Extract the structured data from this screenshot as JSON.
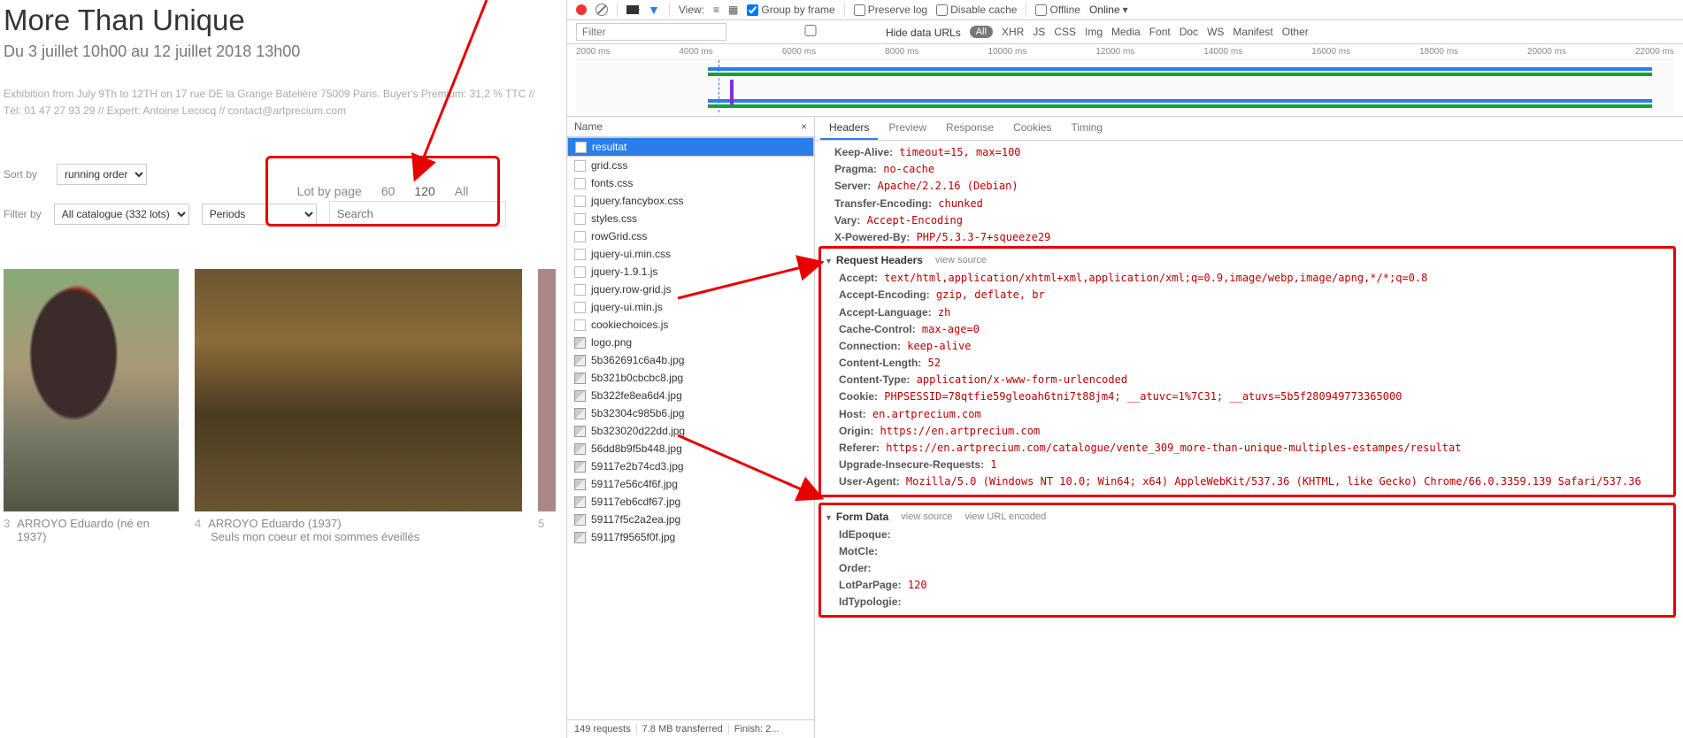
{
  "website": {
    "title": "More Than Unique",
    "subtitle": "Du 3 juillet 10h00 au 12 juillet 2018 13h00",
    "desc": "Exhibition from July 9Th to 12TH on 17 rue DE la Grange Batelière 75009 Paris. Buyer's Premium: 31,2 % TTC // Tél: 01 47 27 93 29 // Expert: Antoine Lecocq // contact@artprecium.com",
    "sort_label": "Sort by",
    "sort_value": "running order",
    "lot_label": "Lot by page",
    "lot_60": "60",
    "lot_120": "120",
    "lot_all": "All",
    "filter_label": "Filter by",
    "filter_all": "All catalogue (332 lots)",
    "filter_periods": "Periods",
    "search_placeholder": "Search",
    "cards": [
      {
        "num": "3",
        "artist": "ARROYO Eduardo (né en 1937)",
        "title": ""
      },
      {
        "num": "4",
        "artist": "ARROYO Eduardo (1937)",
        "title": "Seuls mon coeur et moi sommes éveillés"
      },
      {
        "num": "5",
        "artist": "",
        "title": ""
      }
    ]
  },
  "devtools": {
    "toolbar": {
      "view": "View:",
      "group": "Group by frame",
      "preserve": "Preserve log",
      "disable": "Disable cache",
      "offline": "Offline",
      "online": "Online"
    },
    "filterbar": {
      "placeholder": "Filter",
      "hide": "Hide data URLs",
      "all": "All",
      "types": [
        "XHR",
        "JS",
        "CSS",
        "Img",
        "Media",
        "Font",
        "Doc",
        "WS",
        "Manifest",
        "Other"
      ]
    },
    "timeline_ticks": [
      "2000 ms",
      "4000 ms",
      "6000 ms",
      "8000 ms",
      "10000 ms",
      "12000 ms",
      "14000 ms",
      "16000 ms",
      "18000 ms",
      "20000 ms",
      "22000 ms"
    ],
    "reqlist": {
      "hdr": "Name",
      "items": [
        {
          "name": "resultat",
          "sel": true,
          "img": false
        },
        {
          "name": "grid.css",
          "img": false
        },
        {
          "name": "fonts.css",
          "img": false
        },
        {
          "name": "jquery.fancybox.css",
          "img": false
        },
        {
          "name": "styles.css",
          "img": false
        },
        {
          "name": "rowGrid.css",
          "img": false
        },
        {
          "name": "jquery-ui.min.css",
          "img": false
        },
        {
          "name": "jquery-1.9.1.js",
          "img": false
        },
        {
          "name": "jquery.row-grid.js",
          "img": false
        },
        {
          "name": "jquery-ui.min.js",
          "img": false
        },
        {
          "name": "cookiechoices.js",
          "img": false
        },
        {
          "name": "logo.png",
          "img": true
        },
        {
          "name": "5b362691c6a4b.jpg",
          "img": true
        },
        {
          "name": "5b321b0cbcbc8.jpg",
          "img": true
        },
        {
          "name": "5b322fe8ea6d4.jpg",
          "img": true
        },
        {
          "name": "5b32304c985b6.jpg",
          "img": true
        },
        {
          "name": "5b323020d22dd.jpg",
          "img": true
        },
        {
          "name": "56dd8b9f5b448.jpg",
          "img": true
        },
        {
          "name": "59117e2b74cd3.jpg",
          "img": true
        },
        {
          "name": "59117e56c4f6f.jpg",
          "img": true
        },
        {
          "name": "59117eb6cdf67.jpg",
          "img": true
        },
        {
          "name": "59117f5c2a2ea.jpg",
          "img": true
        },
        {
          "name": "59117f9565f0f.jpg",
          "img": true
        }
      ],
      "status": {
        "req": "149 requests",
        "size": "7.8 MB transferred",
        "finish": "Finish: 2..."
      }
    },
    "detail": {
      "tabs": [
        "Headers",
        "Preview",
        "Response",
        "Cookies",
        "Timing"
      ],
      "top_headers": [
        {
          "k": "Keep-Alive:",
          "v": "timeout=15, max=100"
        },
        {
          "k": "Pragma:",
          "v": "no-cache"
        },
        {
          "k": "Server:",
          "v": "Apache/2.2.16 (Debian)"
        },
        {
          "k": "Transfer-Encoding:",
          "v": "chunked"
        },
        {
          "k": "Vary:",
          "v": "Accept-Encoding"
        },
        {
          "k": "X-Powered-By:",
          "v": "PHP/5.3.3-7+squeeze29"
        }
      ],
      "req_section": "Request Headers",
      "view_source": "view source",
      "req_headers": [
        {
          "k": "Accept:",
          "v": "text/html,application/xhtml+xml,application/xml;q=0.9,image/webp,image/apng,*/*;q=0.8"
        },
        {
          "k": "Accept-Encoding:",
          "v": "gzip, deflate, br"
        },
        {
          "k": "Accept-Language:",
          "v": "zh"
        },
        {
          "k": "Cache-Control:",
          "v": "max-age=0"
        },
        {
          "k": "Connection:",
          "v": "keep-alive"
        },
        {
          "k": "Content-Length:",
          "v": "52"
        },
        {
          "k": "Content-Type:",
          "v": "application/x-www-form-urlencoded"
        },
        {
          "k": "Cookie:",
          "v": "PHPSESSID=78qtfie59gleoah6tni7t88jm4; __atuvc=1%7C31; __atuvs=5b5f280949773365000"
        },
        {
          "k": "Host:",
          "v": "en.artprecium.com"
        },
        {
          "k": "Origin:",
          "v": "https://en.artprecium.com"
        },
        {
          "k": "Referer:",
          "v": "https://en.artprecium.com/catalogue/vente_309_more-than-unique-multiples-estampes/resultat"
        },
        {
          "k": "Upgrade-Insecure-Requests:",
          "v": "1"
        },
        {
          "k": "User-Agent:",
          "v": "Mozilla/5.0 (Windows NT 10.0; Win64; x64) AppleWebKit/537.36 (KHTML, like Gecko) Chrome/66.0.3359.139 Safari/537.36"
        }
      ],
      "form_section": "Form Data",
      "url_encoded": "view URL encoded",
      "form_data": [
        {
          "k": "IdEpoque:",
          "v": ""
        },
        {
          "k": "MotCle:",
          "v": ""
        },
        {
          "k": "Order:",
          "v": ""
        },
        {
          "k": "LotParPage:",
          "v": "120"
        },
        {
          "k": "IdTypologie:",
          "v": ""
        }
      ]
    }
  }
}
